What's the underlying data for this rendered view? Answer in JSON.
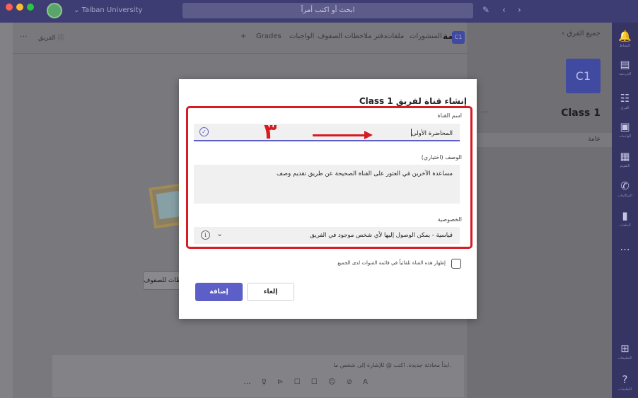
{
  "titlebar": {
    "org_name": "Taiban University",
    "search_placeholder": "ابحث أو اكتب أمراً"
  },
  "rail": {
    "items": [
      "النشاط",
      "الدردشة",
      "الفرق",
      "الواجبات",
      "التقويم",
      "المكالمات",
      "الملفات",
      "...",
      "التطبيقات",
      "التعليمات"
    ]
  },
  "side": {
    "back_label": "جميع الفرق",
    "team_avatar": "C1",
    "team_name": "Class 1",
    "channel_general": "عامة"
  },
  "main": {
    "tab_channel_icon": "C1",
    "tab_general": "عامة",
    "tabs": [
      "المنشورات",
      "ملفات",
      "دفتر ملاحظات الصفوف",
      "الواجبات",
      "Grades"
    ],
    "add_tab": "+",
    "team_badge": "الفريق ⓘ",
    "notes_button": "دفتر ملاحظات للصفوف",
    "compose_placeholder": "ابدأ محادثة جديدة. اكتب @ للإشارة إلى شخص ما.",
    "compose_tools": "… ♀ ⊳ ☐ ☐ ☺ ⊘ A",
    "send_icon": "⊲"
  },
  "modal": {
    "title": "إنشاء قناة لفريق Class 1",
    "name_label": "اسم القناة",
    "name_value": "المحاضرة الأولى",
    "desc_label": "الوصف (اختياري)",
    "desc_value": "مساعدة الآخرين في العثور على القناة الصحيحة عن طريق تقديم وصف",
    "privacy_label": "الخصوصية",
    "privacy_value": "قياسية - يمكن الوصول إليها لأي شخص موجود في الفريق",
    "auto_show_label": "إظهار هذه القناة تلقائياً في قائمة القنوات لدى الجميع",
    "cancel_label": "إلغاء",
    "add_label": "إضافة",
    "annotation_number": "٣",
    "annotation_color": "#d51c23",
    "accent_color": "#5b5fc7"
  }
}
